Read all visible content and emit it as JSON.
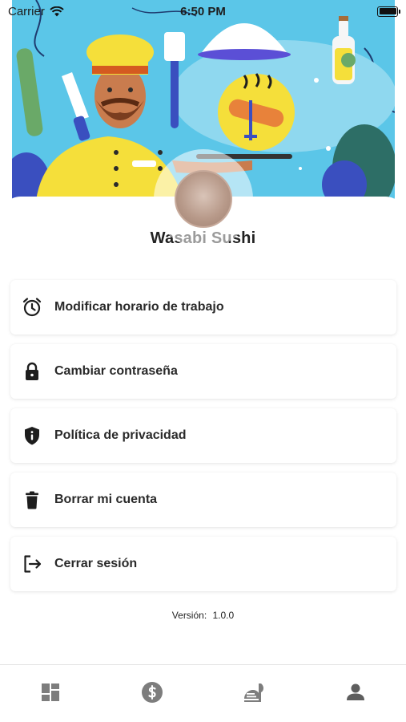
{
  "status_bar": {
    "carrier": "Carrier",
    "time": "6:50 PM"
  },
  "profile": {
    "restaurant_name": "Wasabi Sushi"
  },
  "menu": [
    {
      "label": "Modificar horario de trabajo",
      "icon": "alarm-clock-icon"
    },
    {
      "label": "Cambiar contraseña",
      "icon": "lock-icon"
    },
    {
      "label": "Política de privacidad",
      "icon": "shield-info-icon"
    },
    {
      "label": "Borrar mi cuenta",
      "icon": "trash-icon"
    },
    {
      "label": "Cerrar sesión",
      "icon": "logout-icon"
    }
  ],
  "version": {
    "label": "Versión:",
    "value": "1.0.0"
  },
  "tab_bar": {
    "tabs": [
      {
        "icon": "dashboard-icon",
        "active": false
      },
      {
        "icon": "dollar-icon",
        "active": false
      },
      {
        "icon": "food-menu-icon",
        "active": false
      },
      {
        "icon": "profile-icon",
        "active": true
      }
    ]
  },
  "colors": {
    "banner_sky": "#5bc6e8",
    "chef_yellow": "#f5df3a",
    "icon_gray": "#7d7d7d",
    "icon_dark": "#1d1d1d"
  }
}
